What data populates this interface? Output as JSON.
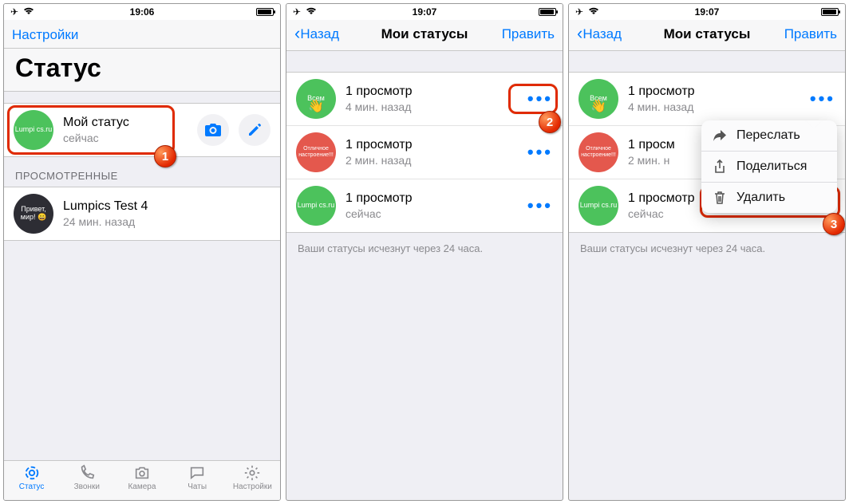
{
  "screen1": {
    "time": "19:06",
    "nav_left": "Настройки",
    "large_title": "Статус",
    "my_status_title": "Мой статус",
    "my_status_sub": "сейчас",
    "my_status_avatar": "Lumpi cs.ru",
    "viewed_header": "ПРОСМОТРЕННЫЕ",
    "viewed_title": "Lumpics Test 4",
    "viewed_sub": "24 мин. назад",
    "viewed_avatar": "Привет, мир! 😄",
    "tabs": {
      "status": "Статус",
      "calls": "Звонки",
      "camera": "Камера",
      "chats": "Чаты",
      "settings": "Настройки"
    }
  },
  "screen2": {
    "time": "19:07",
    "nav_back": "Назад",
    "nav_title": "Мои статусы",
    "nav_right": "Править",
    "rows": [
      {
        "avatar_label": "Всем",
        "avatar_emoji": "👋",
        "title": "1 просмотр",
        "sub": "4 мин. назад"
      },
      {
        "avatar_label": "Отличное настроение!!!",
        "title": "1 просмотр",
        "sub": "2 мин. назад"
      },
      {
        "avatar_label": "Lumpi cs.ru",
        "title": "1 просмотр",
        "sub": "сейчас"
      }
    ],
    "footer": "Ваши статусы исчезнут через 24 часа."
  },
  "screen3": {
    "time": "19:07",
    "nav_back": "Назад",
    "nav_title": "Мои статусы",
    "nav_right": "Править",
    "rows": [
      {
        "avatar_label": "Всем",
        "avatar_emoji": "👋",
        "title": "1 просмотр",
        "sub": "4 мин. назад"
      },
      {
        "avatar_label": "Отличное настроение!!!",
        "title": "1 просм",
        "sub": "2 мин. н"
      },
      {
        "avatar_label": "Lumpi cs.ru",
        "title": "1 просмотр",
        "sub": "сейчас"
      }
    ],
    "popover": {
      "forward": "Переслать",
      "share": "Поделиться",
      "delete": "Удалить"
    },
    "footer": "Ваши статусы исчезнут через 24 часа."
  }
}
